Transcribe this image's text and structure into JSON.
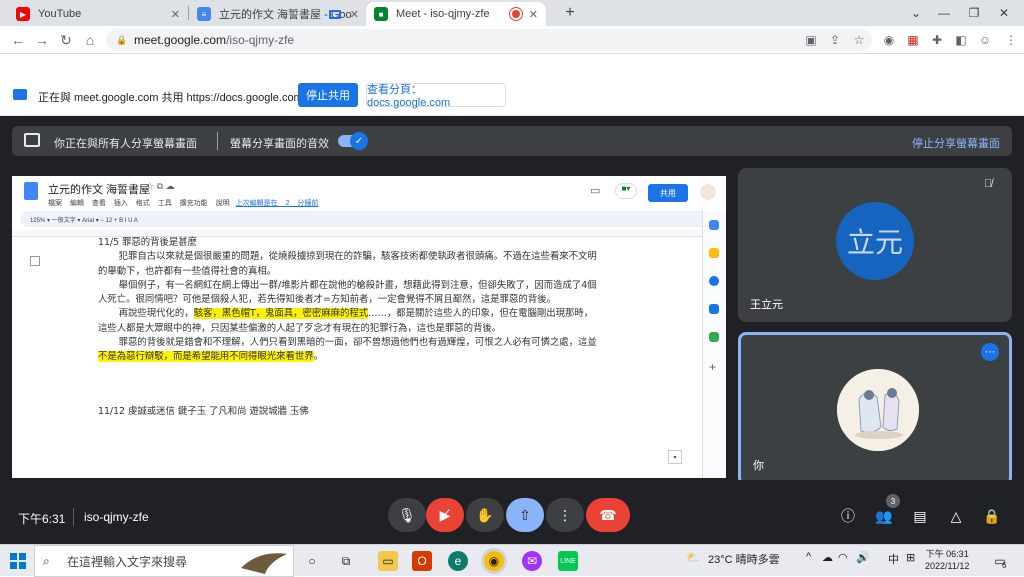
{
  "tabs": [
    {
      "title": "YouTube",
      "icon": "youtube-icon",
      "color": "#ff0000"
    },
    {
      "title": "立元的作文 海誓書屋 - Goo",
      "icon": "docs-icon",
      "color": "#4285f4"
    },
    {
      "title": "Meet - iso-qjmy-zfe",
      "icon": "meet-icon",
      "color": "#00832d"
    }
  ],
  "address": {
    "host": "meet.google.com",
    "path": "/iso-qjmy-zfe"
  },
  "share_bar": {
    "message": "正在與 meet.google.com 共用 https://docs.google.com",
    "stop_label": "停止共用",
    "view_label": "查看分頁：docs.google.com"
  },
  "presenting": {
    "text": "你正在與所有人分享螢幕畫面",
    "audio_text": "螢幕分享畫面的音效",
    "stop_label": "停止分享螢幕畫面"
  },
  "docs": {
    "title": "立元的作文 海誓書屋",
    "menu": "檔案 編輯 查看 插入 格式 工具 擴充功能 說明",
    "last_edit": "上次編輯是在 2 分鐘前",
    "share_label": "共用",
    "toolbar": "125% ▾   一般文字 ▾   Arial ▾   −  12  +   B  I  U  A",
    "heading": "11/5 罪惡的背後是甚麼",
    "p1": "犯罪自古以來就是個很嚴重的問題，從燒殺擄掠到現在的詐騙，駭客技術都使執政者很頭痛。不過在這些看來不文明的舉動下，也許都有一些值得社會的真相。",
    "p2": "舉個例子，有一名網紅在網上傳出一群/堆影片都在說他的槍殺計畫，想藉此得到注意，但卻失敗了，因而造成了4個人死亡。很同情吧？可他是個殺人犯，若先得知後者才=方知前者，一定會覺得不屑且鄙然，這是罪惡的背後。",
    "p3a": "再說些現代化的，",
    "p3hl": "駭客，黑色帽T，鬼面具，密密麻麻的程式",
    "p3b": "……，都是關於這些人的印象，但在電腦剛出現那時，這些人都是大眾眼中的神，只因某些偏激的人起了歹念才有現在的犯罪行為，這也是罪惡的背後。",
    "p4a": "罪惡的背後就是錯會和不理解，人們只看到黑暗的一面，卻不曾想過他們也有過輝煌，可恨之人必有可憐之處，這並",
    "p4hl": "不是為惡行辯駁，而是希望能用不同得眼光來看世界",
    "p4b": "。",
    "heading2": "11/12 虔誠或迷信 鍵子玉 了凡和尚 遊說城牆 玉佛"
  },
  "participants": [
    {
      "name": "王立元",
      "avatar_text": "立元"
    },
    {
      "name": "你"
    }
  ],
  "controls": {
    "time": "下午6:31",
    "meeting_code": "iso-qjmy-zfe",
    "people_count": "3"
  },
  "taskbar": {
    "search_placeholder": "在這裡輸入文字來搜尋",
    "weather": "23°C 晴時多雲",
    "ime": "中",
    "clock_time": "下午 06:31",
    "clock_date": "2022/11/12",
    "notifications": "6"
  }
}
